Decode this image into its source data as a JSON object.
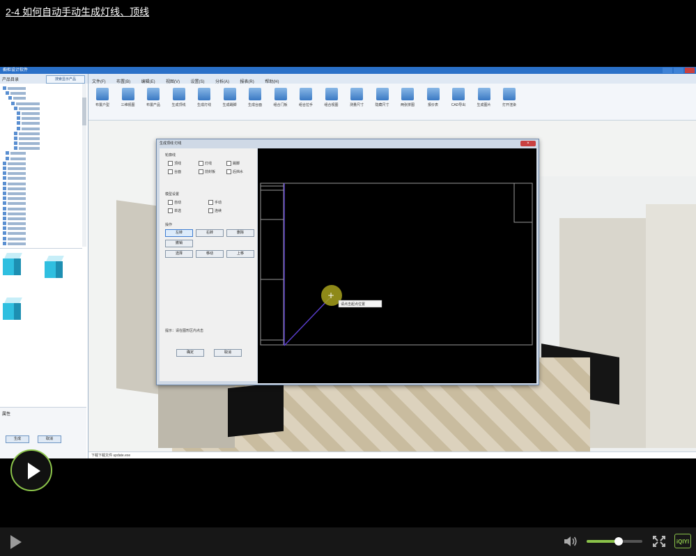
{
  "page": {
    "title": "2-4  如何自动手动生成灯线、顶线"
  },
  "player": {
    "big_play_icon": "play-circle-icon",
    "controls_play_icon": "play-icon",
    "volume_icon": "speaker-icon",
    "volume_level": 0.58,
    "fullscreen_icon": "fullscreen-icon",
    "brand": "iQIYI",
    "accent_color": "#8bc34a"
  },
  "video_frame": {
    "app_title": "橱柜设计软件",
    "menu": [
      "文件(F)",
      "布置(B)",
      "编辑(E)",
      "视图(V)",
      "设置(S)",
      "分析(A)",
      "报表(R)",
      "帮助(H)"
    ],
    "toolbar": [
      "布置户型",
      "三维视图",
      "布置产品",
      "生成顶线",
      "生成灯线",
      "生成踢脚",
      "生成台面",
      "组合门板",
      "组合拉手",
      "组合视图",
      "测量尺寸",
      "隐藏尺寸",
      "两张拼图",
      "报价表",
      "CAD导出",
      "生成图片",
      "打开渲染"
    ],
    "dialog": {
      "title": "生成顶线   灯线",
      "group1": "轮廓线",
      "checks1": [
        "顶线",
        "灯线",
        "踢脚",
        "台面",
        "前封板",
        "后挡水"
      ],
      "group2": "模型设置",
      "checks2": [
        "自动",
        "手动",
        "单选",
        "连续"
      ],
      "group3": "操作",
      "buttons1": [
        "左转",
        "右转",
        "删除"
      ],
      "button_single": "撤销",
      "buttons2": [
        "选择",
        "移动",
        "上移"
      ],
      "hint": "提示：请在图形区内点击",
      "ok": "确定",
      "cancel": "取消",
      "tooltip": "请点击起点位置"
    },
    "left_panel": {
      "header": "产品目录",
      "button": "搜索显示产品",
      "attrs_header": "属性",
      "btn_ok": "生成",
      "btn_cancel": "取消"
    },
    "status": "下载下载文件 update.exe"
  }
}
